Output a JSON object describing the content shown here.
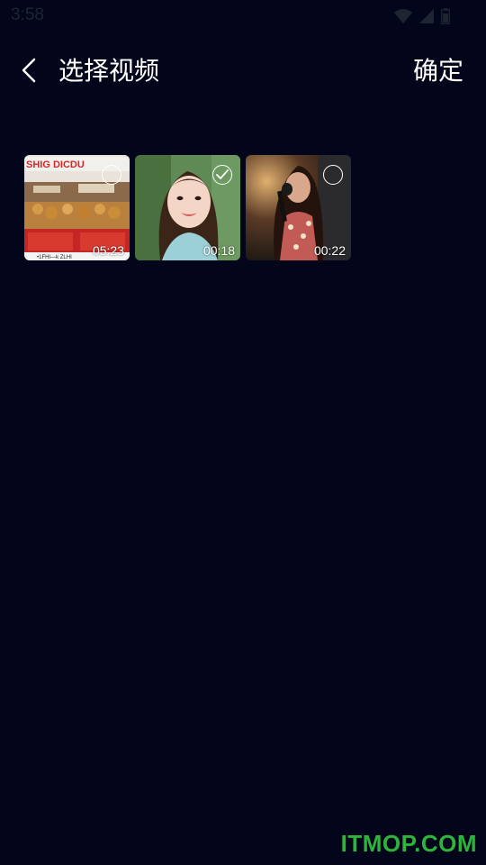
{
  "status_bar": {
    "time": "3:58",
    "icons": [
      "wifi-icon",
      "signal-icon",
      "battery-icon"
    ]
  },
  "header": {
    "back_icon": "chevron-left-icon",
    "title": "选择视频",
    "confirm_label": "确定"
  },
  "videos": [
    {
      "duration": "05:23",
      "checked": false,
      "thumb_text": "SHIG DICDU",
      "thumb_subtitle": "•1FHI—k ZLHI"
    },
    {
      "duration": "00:18",
      "checked": true
    },
    {
      "duration": "00:22",
      "checked": false
    }
  ],
  "watermark": "ITMOP.COM",
  "colors": {
    "background": "#03061a",
    "text": "#ffffff",
    "watermark": "#2db43b"
  }
}
